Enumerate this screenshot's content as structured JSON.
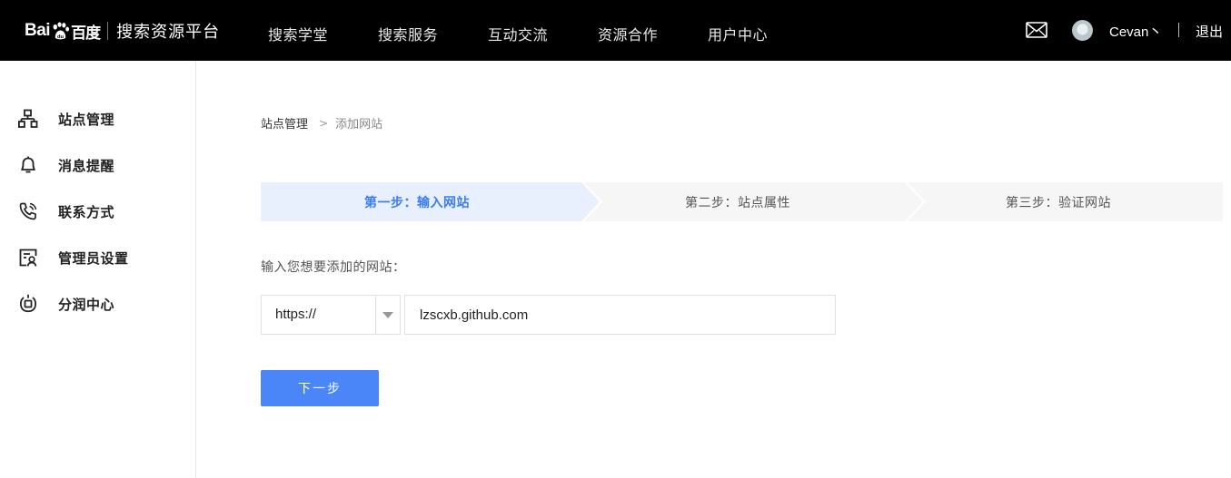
{
  "header": {
    "logo_bai": "Bai",
    "logo_du": "百度",
    "product_title": "搜索资源平台",
    "nav": [
      {
        "label": "搜索学堂"
      },
      {
        "label": "搜索服务"
      },
      {
        "label": "互动交流"
      },
      {
        "label": "资源合作"
      },
      {
        "label": "用户中心"
      }
    ],
    "username": "Cevan丶",
    "logout_label": "退出"
  },
  "sidebar": {
    "items": [
      {
        "label": "站点管理",
        "icon": "sitemap-icon"
      },
      {
        "label": "消息提醒",
        "icon": "bell-icon"
      },
      {
        "label": "联系方式",
        "icon": "phone-icon"
      },
      {
        "label": "管理员设置",
        "icon": "admin-settings-icon"
      },
      {
        "label": "分润中心",
        "icon": "revenue-share-icon"
      }
    ]
  },
  "breadcrumb": {
    "parent": "站点管理",
    "separator": ">",
    "current": "添加网站"
  },
  "steps": [
    {
      "label": "第一步：输入网站",
      "state": "active"
    },
    {
      "label": "第二步：站点属性",
      "state": "inactive"
    },
    {
      "label": "第三步：验证网站",
      "state": "inactive"
    }
  ],
  "form": {
    "prompt": "输入您想要添加的网站：",
    "protocol_value": "https://",
    "site_value": "lzscxb.github.com",
    "next_label": "下一步"
  },
  "colors": {
    "topbar_bg": "#000000",
    "accent": "#4a86f7",
    "active_step_bg": "#e8f0fd",
    "inactive_step_bg": "#f6f6f6"
  }
}
